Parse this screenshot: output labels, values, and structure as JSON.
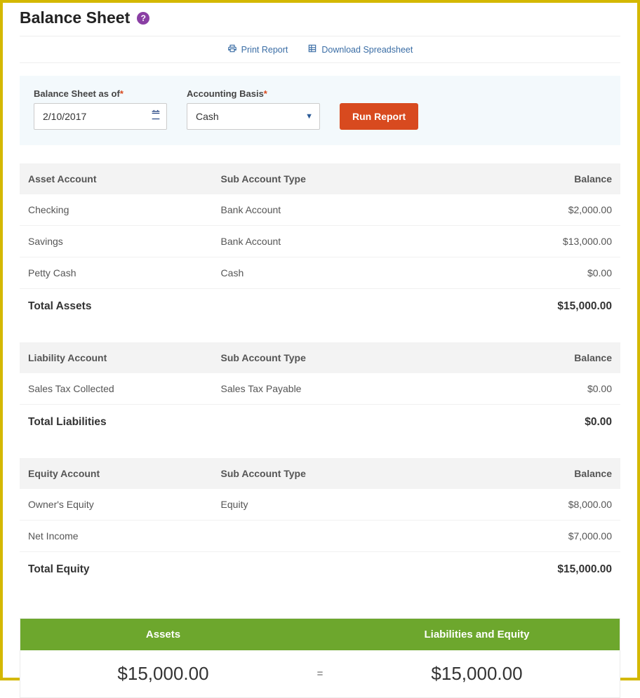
{
  "title": "Balance Sheet",
  "actions": {
    "print": "Print Report",
    "download": "Download Spreadsheet"
  },
  "filters": {
    "date_label": "Balance Sheet as of",
    "date_value": "2/10/2017",
    "basis_label": "Accounting Basis",
    "basis_value": "Cash",
    "run_label": "Run Report"
  },
  "sections": {
    "assets": {
      "headers": {
        "name": "Asset Account",
        "sub": "Sub Account Type",
        "bal": "Balance"
      },
      "rows": [
        {
          "name": "Checking",
          "sub": "Bank Account",
          "bal": "$2,000.00"
        },
        {
          "name": "Savings",
          "sub": "Bank Account",
          "bal": "$13,000.00"
        },
        {
          "name": "Petty Cash",
          "sub": "Cash",
          "bal": "$0.00"
        }
      ],
      "total_label": "Total Assets",
      "total_value": "$15,000.00"
    },
    "liabilities": {
      "headers": {
        "name": "Liability Account",
        "sub": "Sub Account Type",
        "bal": "Balance"
      },
      "rows": [
        {
          "name": "Sales Tax Collected",
          "sub": "Sales Tax Payable",
          "bal": "$0.00"
        }
      ],
      "total_label": "Total Liabilities",
      "total_value": "$0.00"
    },
    "equity": {
      "headers": {
        "name": "Equity Account",
        "sub": "Sub Account Type",
        "bal": "Balance"
      },
      "rows": [
        {
          "name": "Owner's Equity",
          "sub": "Equity",
          "bal": "$8,000.00"
        },
        {
          "name": "Net Income",
          "sub": "",
          "bal": "$7,000.00"
        }
      ],
      "total_label": "Total Equity",
      "total_value": "$15,000.00"
    }
  },
  "summary": {
    "left_label": "Assets",
    "right_label": "Liabilities and Equity",
    "left_value": "$15,000.00",
    "right_value": "$15,000.00",
    "equals": "="
  }
}
